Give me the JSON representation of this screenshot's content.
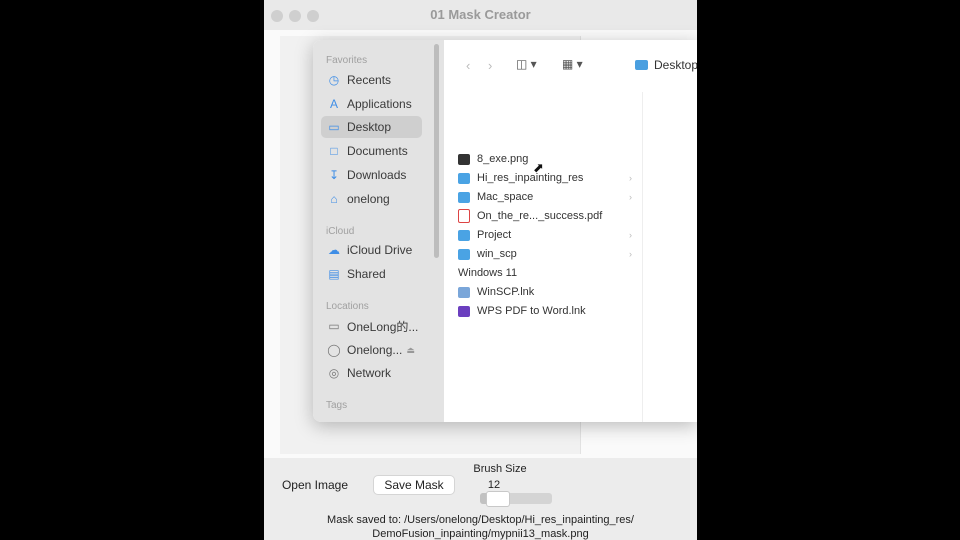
{
  "window": {
    "title": "01 Mask Creator"
  },
  "dialog": {
    "sidebar": {
      "favorites_label": "Favorites",
      "favorites": [
        {
          "label": "Recents",
          "icon": "clock-icon"
        },
        {
          "label": "Applications",
          "icon": "applications-icon"
        },
        {
          "label": "Desktop",
          "icon": "desktop-icon"
        },
        {
          "label": "Documents",
          "icon": "document-icon"
        },
        {
          "label": "Downloads",
          "icon": "download-icon"
        },
        {
          "label": "onelong",
          "icon": "home-icon"
        }
      ],
      "icloud_label": "iCloud",
      "icloud": [
        {
          "label": "iCloud Drive",
          "icon": "cloud-icon"
        },
        {
          "label": "Shared",
          "icon": "shared-folder-icon"
        }
      ],
      "locations_label": "Locations",
      "locations": [
        {
          "label": "OneLong的...",
          "icon": "computer-icon"
        },
        {
          "label": "Onelong...",
          "icon": "disk-icon"
        },
        {
          "label": "Network",
          "icon": "network-icon"
        }
      ],
      "tags_label": "Tags"
    },
    "location": "Desktop",
    "files": [
      {
        "name": "8_exe.png",
        "type": "png"
      },
      {
        "name": "Hi_res_inpainting_res",
        "type": "folder"
      },
      {
        "name": "Mac_space",
        "type": "folder"
      },
      {
        "name": "On_the_re..._success.pdf",
        "type": "pdf"
      },
      {
        "name": "Project",
        "type": "folder"
      },
      {
        "name": "win_scp",
        "type": "folder"
      },
      {
        "name": "Windows 11",
        "type": "win"
      },
      {
        "name": "WinSCP.lnk",
        "type": "lnk"
      },
      {
        "name": "WPS PDF to Word.lnk",
        "type": "wps"
      }
    ]
  },
  "controls": {
    "open_label": "Open Image",
    "save_label": "Save Mask",
    "brush_label": "Brush Size",
    "brush_value": "12",
    "brush_fraction": 0.2
  },
  "status": {
    "line1": "Mask saved to: /Users/onelong/Desktop/Hi_res_inpainting_res/",
    "line2": "DemoFusion_inpainting/mypnii13_mask.png"
  },
  "colors": {
    "accent": "#3f8ee6",
    "folder": "#4aa3e4"
  }
}
